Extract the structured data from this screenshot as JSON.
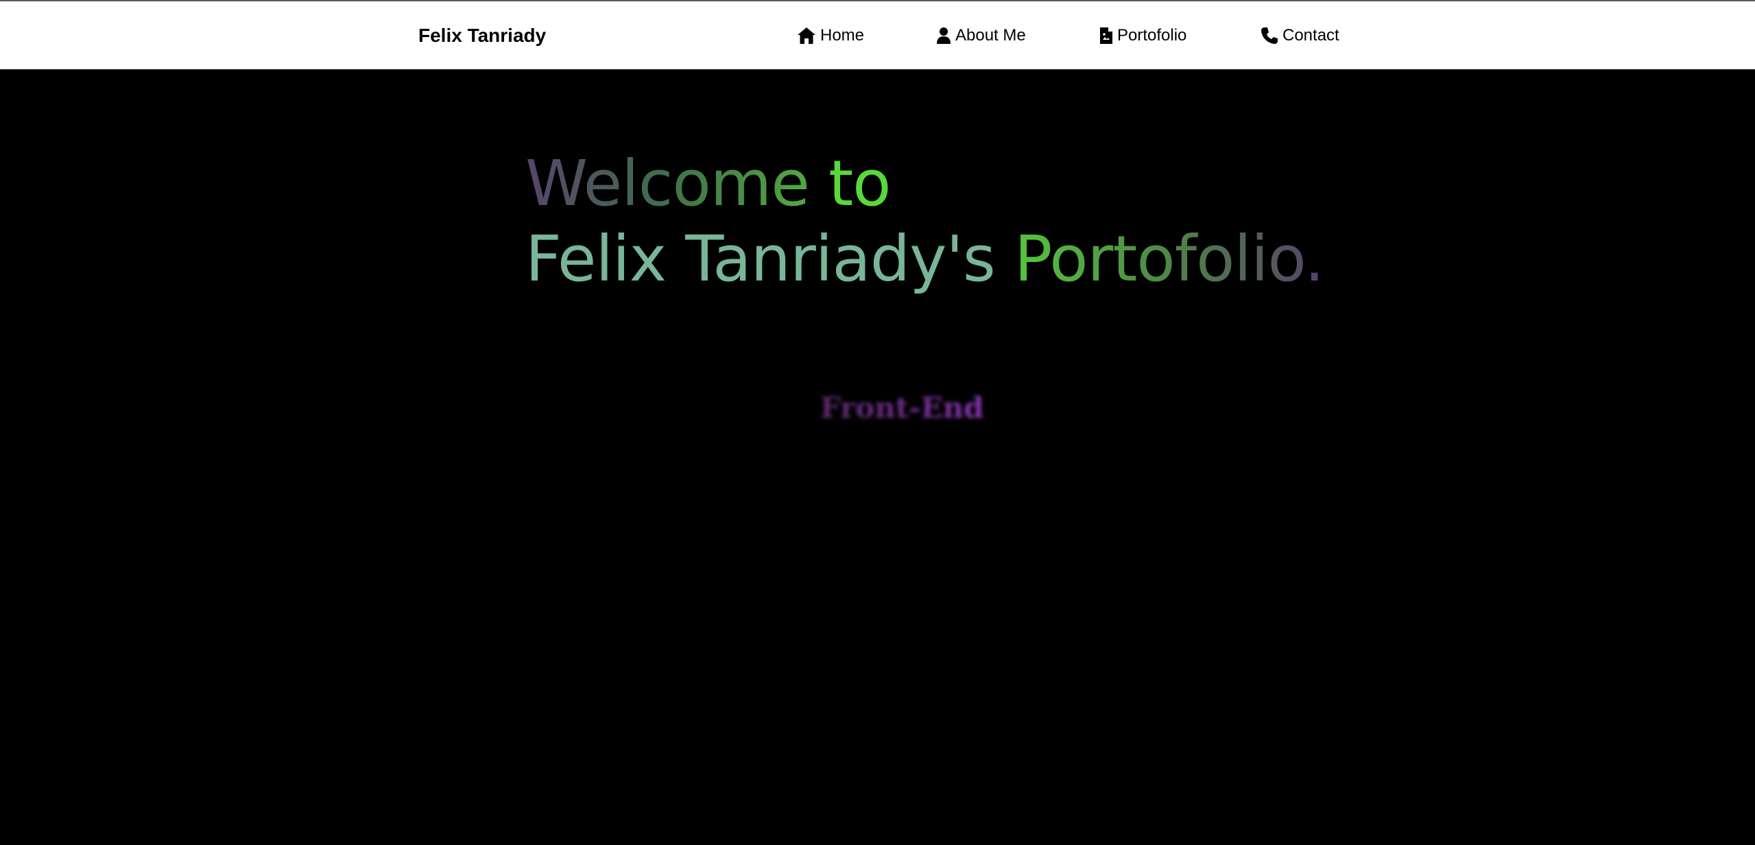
{
  "navbar": {
    "brand": "Felix Tanriady",
    "items": [
      {
        "label": "Home",
        "icon": "home-icon"
      },
      {
        "label": "About Me",
        "icon": "user-icon"
      },
      {
        "label": "Portofolio",
        "icon": "document-icon"
      },
      {
        "label": "Contact",
        "icon": "phone-icon"
      }
    ]
  },
  "hero": {
    "welcome": "Welcome ",
    "to": "to",
    "name": "Felix Tanriady's ",
    "portfolio": "Portofolio.",
    "role": "Front-End"
  },
  "colors": {
    "navbar_bg": "#ffffff",
    "page_bg": "#000000",
    "accent_green": "#58d83a",
    "accent_teal": "#79b597",
    "accent_purple": "#6d2e8c"
  }
}
